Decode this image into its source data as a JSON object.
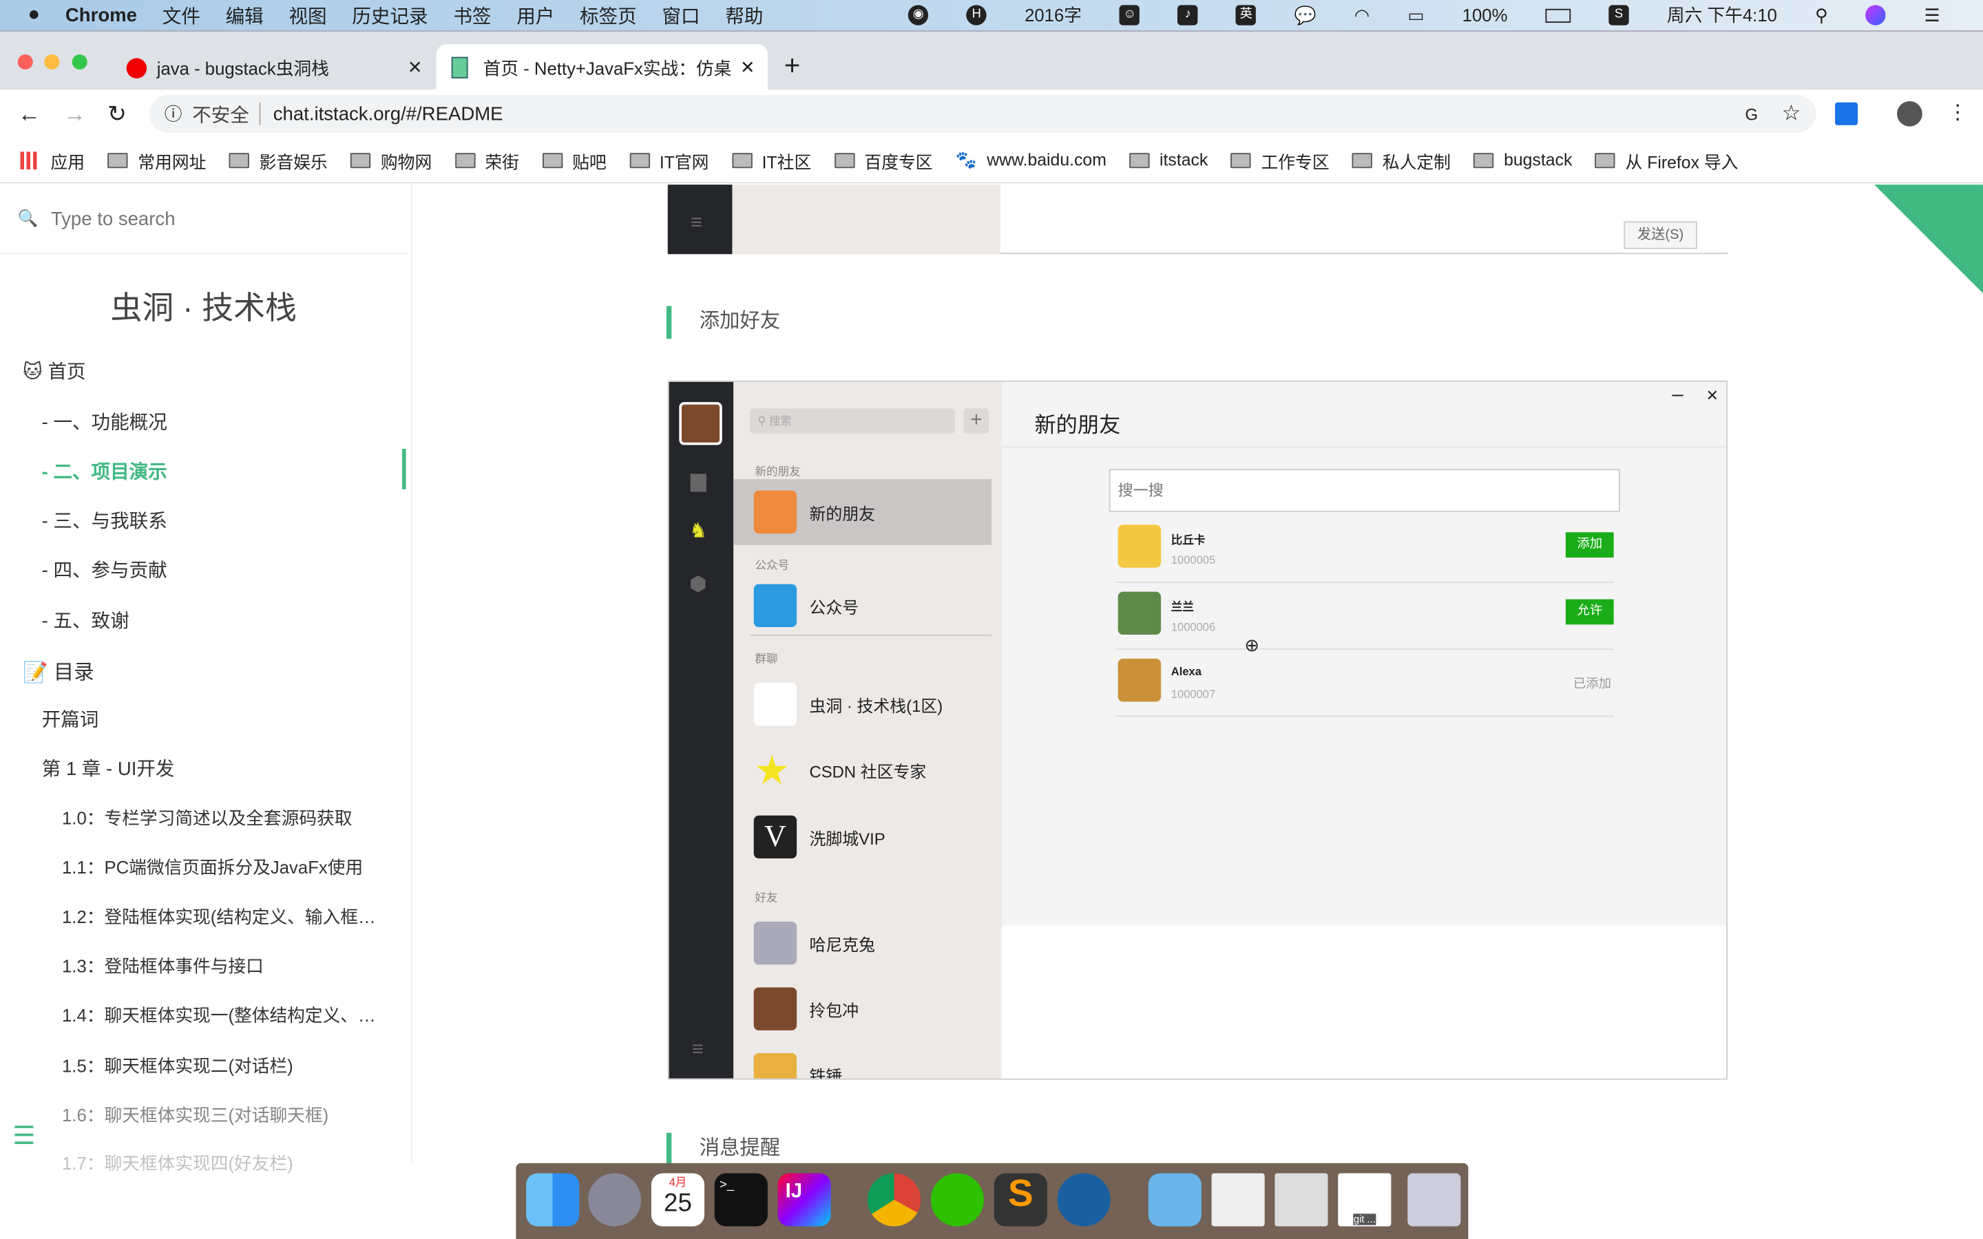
{
  "menubar": {
    "app": "Chrome",
    "items": [
      "文件",
      "编辑",
      "视图",
      "历史记录",
      "书签",
      "用户",
      "标签页",
      "窗口",
      "帮助"
    ],
    "word_count": "2016字",
    "ime": "英",
    "battery": "100%",
    "clock": "周六 下午4:10"
  },
  "tabs": [
    {
      "title": "java - bugstack虫洞栈",
      "active": false
    },
    {
      "title": "首页 - Netty+JavaFx实战：仿桌",
      "active": true
    }
  ],
  "toolbar": {
    "security": "不安全",
    "url": "chat.itstack.org/#/README"
  },
  "bookmarks": [
    "应用",
    "常用网址",
    "影音娱乐",
    "购物网",
    "荣街",
    "贴吧",
    "IT官网",
    "IT社区",
    "百度专区",
    "www.baidu.com",
    "itstack",
    "工作专区",
    "私人定制",
    "bugstack",
    "从 Firefox 导入"
  ],
  "sidebar": {
    "search_placeholder": "Type to search",
    "title": "虫洞 · 技术栈",
    "items": [
      {
        "label": "首页",
        "level": 0,
        "icon": "github-cat-icon"
      },
      {
        "label": "- 一、功能概况",
        "level": 1
      },
      {
        "label": "- 二、项目演示",
        "level": 1,
        "active": true
      },
      {
        "label": "- 三、与我联系",
        "level": 1
      },
      {
        "label": "- 四、参与贡献",
        "level": 1
      },
      {
        "label": "- 五、致谢",
        "level": 1
      },
      {
        "label": "目录",
        "level": 0,
        "icon": "memo-icon"
      },
      {
        "label": "开篇词",
        "level": 1
      },
      {
        "label": "第 1 章 - UI开发",
        "level": 1
      },
      {
        "label": "1.0：专栏学习简述以及全套源码获取",
        "level": 2
      },
      {
        "label": "1.1：PC端微信页面拆分及JavaFx使用",
        "level": 2
      },
      {
        "label": "1.2：登陆框体实现(结构定义、输入框…",
        "level": 2
      },
      {
        "label": "1.3：登陆框体事件与接口",
        "level": 2
      },
      {
        "label": "1.4：聊天框体实现一(整体结构定义、…",
        "level": 2
      },
      {
        "label": "1.5：聊天框体实现二(对话栏)",
        "level": 2
      },
      {
        "label": "1.6：聊天框体实现三(对话聊天框)",
        "level": 2
      },
      {
        "label": "1.7：聊天框体实现四(好友栏)",
        "level": 2
      }
    ],
    "accent": "#42b983"
  },
  "main": {
    "send_button": "发送(S)",
    "heading_add_friend": "添加好友",
    "heading_notify": "消息提醒"
  },
  "app": {
    "search_placeholder": "搜索",
    "sections": [
      "新的朋友",
      "公众号",
      "群聊",
      "好友"
    ],
    "list": [
      {
        "name": "新的朋友",
        "selected": true
      },
      {
        "name": "公众号"
      },
      {
        "name": "虫洞 · 技术栈(1区)"
      },
      {
        "name": "CSDN 社区专家"
      },
      {
        "name": "洗脚城VIP"
      },
      {
        "name": "哈尼克兔"
      },
      {
        "name": "拎包冲"
      },
      {
        "name": "铁锤"
      }
    ],
    "panel_title": "新的朋友",
    "panel_search_placeholder": "搜一搜",
    "friends": [
      {
        "name": "比丘卡",
        "id": "1000005",
        "action": "添加"
      },
      {
        "name": "兰兰",
        "id": "1000006",
        "action": "允许"
      },
      {
        "name": "Alexa",
        "id": "1000007",
        "action": "已添加"
      }
    ],
    "green": "#1aad19"
  },
  "dock": {
    "calendar_month": "4月",
    "calendar_day": "25",
    "git_label": "git ..."
  }
}
